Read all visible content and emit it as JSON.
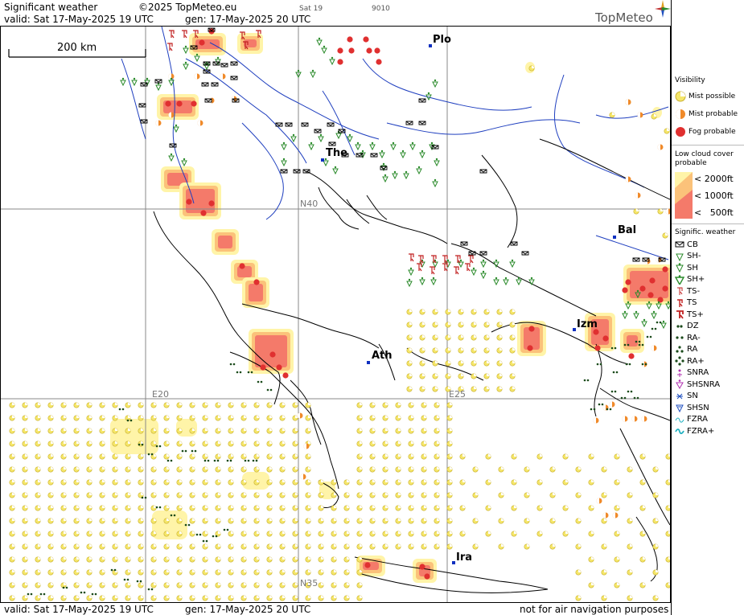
{
  "header": {
    "title": "Significant weather",
    "copyright": "©2025 TopMeteo.eu",
    "valid": "valid:  Sat  17-May-2025  19 UTC",
    "gen": "gen: 17-May-2025 20 UTC",
    "mini_day": "Sat 19",
    "mini_code": "9010",
    "brand": "TopMeteo"
  },
  "scale_bar": "200 km",
  "cities": [
    {
      "label": "Plo"
    },
    {
      "label": "The"
    },
    {
      "label": "Bal"
    },
    {
      "label": "Izm"
    },
    {
      "label": "Ath"
    },
    {
      "label": "Ira"
    }
  ],
  "grid_labels": {
    "n40": "N40",
    "n35": "N35",
    "e20": "E20",
    "e25": "E25"
  },
  "legend": {
    "visibility_title": "Visibility",
    "visibility": [
      "Mist possible",
      "Mist probable",
      "Fog probable"
    ],
    "lowcloud_title": "Low cloud cover probable",
    "lowcloud": [
      "< 2000ft",
      "< 1000ft",
      "<   500ft"
    ],
    "sigwx_title": "Signific. weather",
    "sigwx": [
      "CB",
      "SH-",
      "SH",
      "SH+",
      "TS-",
      "TS",
      "TS+",
      "DZ",
      "RA-",
      "RA",
      "RA+",
      "SNRA",
      "SHSNRA",
      "SN",
      "SHSN",
      "FZRA",
      "FZRA+"
    ]
  },
  "colors": {
    "land_line": "#000000",
    "river": "#1f3fbf",
    "grid": "#888888",
    "mist_possible": "#f5e66a",
    "mist_probable": "#f08a2a",
    "fog_probable": "#e03030",
    "lowcloud_2000": "#fff4a8",
    "lowcloud_1000": "#fbc27a",
    "lowcloud_500": "#f47a6a",
    "shower": "#2a8a2a",
    "thunder": "#c02020",
    "rain": "#1a4a1a"
  },
  "footer": {
    "valid": "valid:  Sat  17-May-2025  19 UTC",
    "gen": "gen: 17-May-2025 20 UTC",
    "disclaimer": "not for air navigation purposes"
  }
}
